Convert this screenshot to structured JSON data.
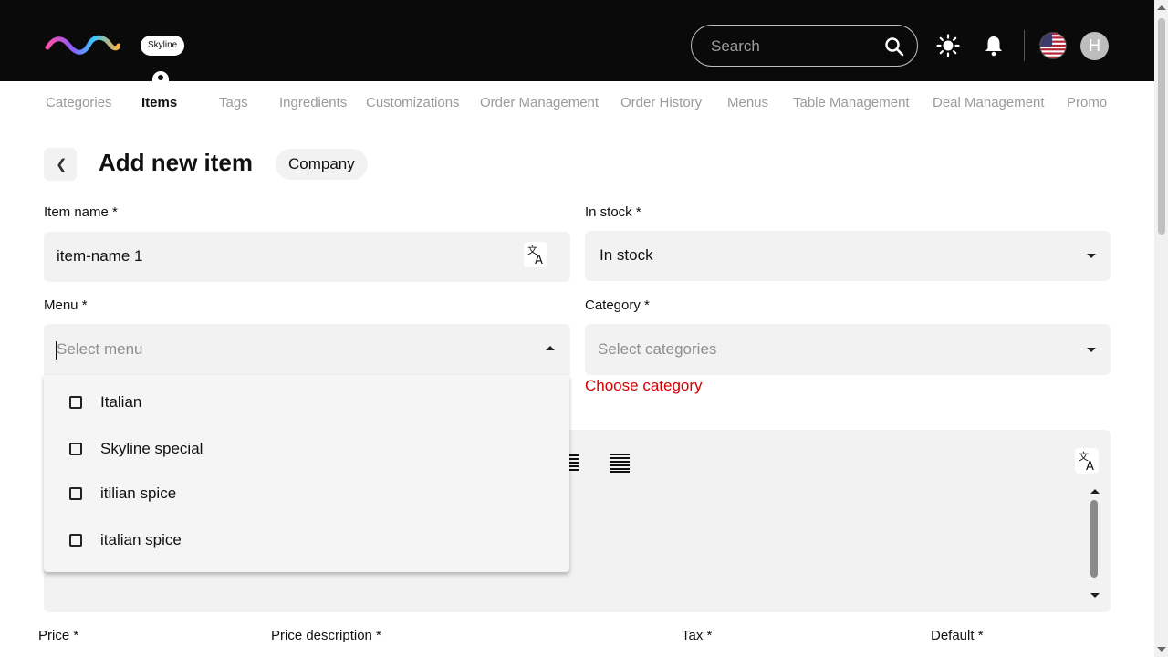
{
  "header": {
    "brand_label": "Skyline",
    "search_placeholder": "Search",
    "avatar_initial": "H"
  },
  "nav": {
    "tabs": [
      {
        "label": "Categories"
      },
      {
        "label": "Items",
        "active": true
      },
      {
        "label": "Tags"
      },
      {
        "label": "Ingredients"
      },
      {
        "label": "Customizations"
      },
      {
        "label": "Order Management"
      },
      {
        "label": "Order History"
      },
      {
        "label": "Menus"
      },
      {
        "label": "Table Management"
      },
      {
        "label": "Deal Management"
      },
      {
        "label": "Promo"
      }
    ]
  },
  "page": {
    "title": "Add new item",
    "company_chip": "Company"
  },
  "form": {
    "item_name_label": "Item name *",
    "item_name_value": "item-name 1",
    "in_stock_label": "In stock *",
    "in_stock_value": "In stock",
    "menu_label": "Menu *",
    "menu_placeholder": "Select menu",
    "category_label": "Category *",
    "category_placeholder": "Select categories",
    "category_error": "Choose category",
    "menu_options": [
      "Italian",
      "Skyline special",
      "itilian spice",
      "italian spice"
    ],
    "price_label": "Price *",
    "price_description_label": "Price description *",
    "tax_label": "Tax *",
    "default_label": "Default *"
  },
  "colors": {
    "header_bg": "#0a0a0a",
    "field_bg": "#f2f2f2",
    "error": "#d40000",
    "inactive_tab": "#9a9a9a"
  }
}
